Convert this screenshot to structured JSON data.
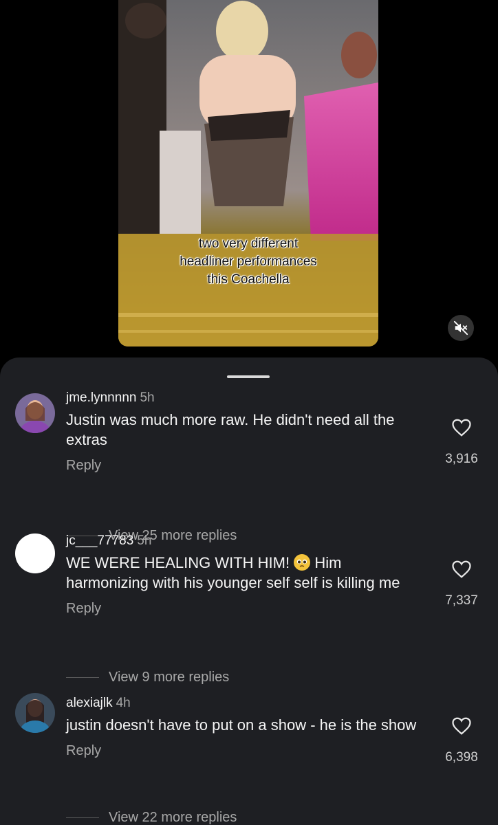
{
  "video": {
    "caption_lines": [
      "two very different",
      "headliner performances",
      "this Coachella"
    ]
  },
  "comments": [
    {
      "username": "jme.lynnnnn",
      "time": "5h",
      "text": "Justin was much more raw. He didn't need all the extras",
      "reply_label": "Reply",
      "view_replies": "View 25 more replies",
      "likes": "3,916"
    },
    {
      "username": "jc___77783",
      "time": "5h",
      "text_before_emoji": "WE WERE HEALING WITH HIM!",
      "emoji": "pleading-face",
      "text_after_emoji": "Him harmonizing with his younger self self is killing me",
      "reply_label": "Reply",
      "view_replies": "View 9 more replies",
      "likes": "7,337"
    },
    {
      "username": "alexiajlk",
      "time": "4h",
      "text": "justin doesn't have to put on a show - he is the show",
      "reply_label": "Reply",
      "view_replies": "View 22 more replies",
      "likes": "6,398"
    }
  ],
  "colors": {
    "sheet_bg": "#1e1f23",
    "secondary_text": "#a8a8a8"
  }
}
